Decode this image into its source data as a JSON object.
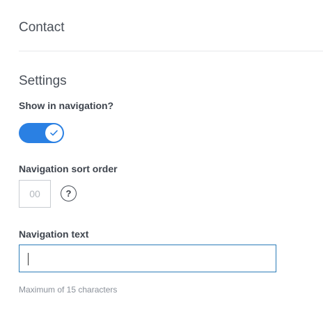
{
  "header": {
    "title": "Contact"
  },
  "settings": {
    "section_title": "Settings",
    "show_in_navigation": {
      "label": "Show in navigation?",
      "checked": true,
      "accent_color": "#2a80e3",
      "knob_icon": "check-icon"
    },
    "sort_order": {
      "label": "Navigation sort order",
      "value": "",
      "placeholder": "00",
      "help_icon": "question-mark-icon",
      "help_glyph": "?"
    },
    "navigation_text": {
      "label": "Navigation text",
      "value": "",
      "focus_color": "#2a7bb8",
      "helper": "Maximum of 15 characters"
    }
  }
}
